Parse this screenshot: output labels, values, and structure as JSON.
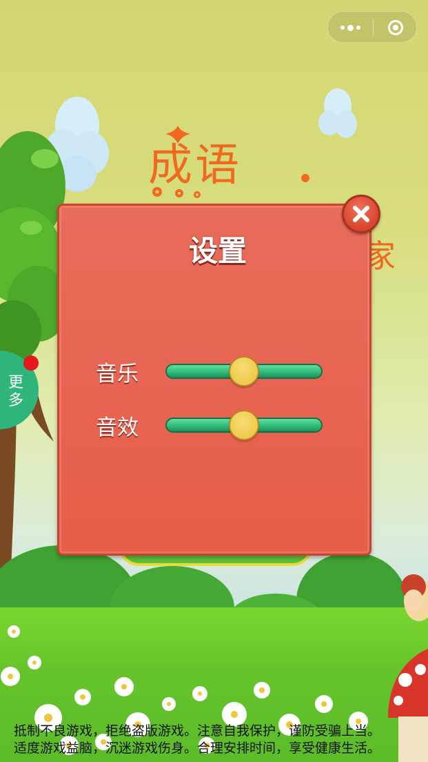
{
  "capsule": {
    "more_icon": "more-dots-icon",
    "close_icon": "target-close-icon"
  },
  "title": {
    "main": "成语",
    "suffix": "家"
  },
  "side_tab": {
    "label_line1": "更",
    "label_line2": "多"
  },
  "settings": {
    "title": "设置",
    "close_icon": "close-x-icon",
    "music": {
      "label": "音乐",
      "level": 0.5
    },
    "sfx": {
      "label": "音效",
      "level": 0.5
    }
  },
  "notice": {
    "line1": "抵制不良游戏，拒绝盗版游戏。注意自我保护，谨防受骗上当。",
    "line2": "适度游戏益脑，沉迷游戏伤身。合理安排时间，享受健康生活。"
  },
  "colors": {
    "dialog": "#e6604c",
    "slider_track": "#2fb878",
    "slider_thumb": "#f2cf58",
    "title_orange": "#f0691e"
  }
}
